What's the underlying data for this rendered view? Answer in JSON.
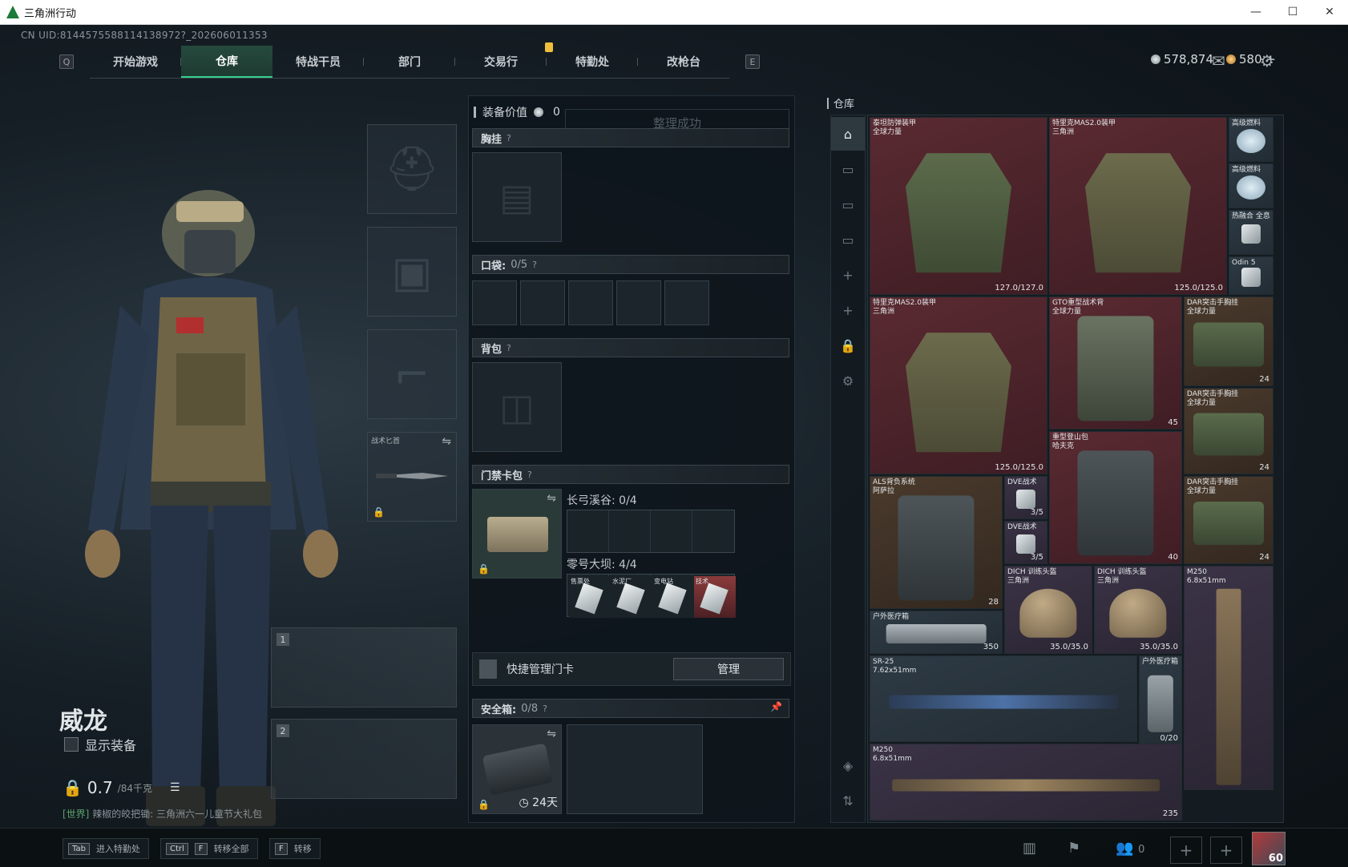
{
  "window": {
    "title": "三角洲行动",
    "minimize": "—",
    "maximize": "☐",
    "close": "✕"
  },
  "uid": "CN UID:8144575588114138972?_202606011353",
  "nav": {
    "left_key": "Q",
    "right_key": "E",
    "tabs": [
      "开始游戏",
      "仓库",
      "特战干员",
      "部门",
      "交易行",
      "特勤处",
      "改枪台"
    ],
    "active_tab": "仓库"
  },
  "currency": {
    "silver": "578,874",
    "gold": "580",
    "gold_plus": "+"
  },
  "operator": {
    "name": "威龙",
    "show_equipment": "显示装备",
    "weight": "0.7",
    "weight_max": "/84千克",
    "chat_channel": "[世界]",
    "chat_text": "辣椒的皎把锄: 三角洲六一儿童节大礼包"
  },
  "equip_slots": {
    "melee_label": "战术匕首",
    "weapon1_num": "1",
    "weapon2_num": "2"
  },
  "middle": {
    "equip_value_label": "装备价值",
    "equip_value": "0",
    "toast": "整理成功",
    "chest_rig": "胸挂",
    "pockets": "口袋:",
    "pockets_count": "0/5",
    "backpack": "背包",
    "keycard_wallet": "门禁卡包",
    "changgong_label": "长弓溪谷: 0/4",
    "linghao_label": "零号大坝: 4/4",
    "keycards": [
      {
        "name": "售票处",
        "color": "blue"
      },
      {
        "name": "水泥厂",
        "color": "blue"
      },
      {
        "name": "变电站",
        "color": "blue"
      },
      {
        "name": "技术",
        "color": "red"
      }
    ],
    "quick_manage": "快捷管理门卡",
    "manage_button": "管理",
    "safe_box": "安全箱:",
    "safe_box_count": "0/8",
    "safe_timer": "24天",
    "question": "?"
  },
  "stash": {
    "title": "仓库",
    "items": [
      {
        "name": "泰坦防弹装甲\n全球力量",
        "durability": "127.0/127.0"
      },
      {
        "name": "特里克MAS2.0装甲\n三角洲",
        "durability": "125.0/125.0"
      },
      {
        "name": "高级燃料",
        "durability": ""
      },
      {
        "name": "高级燃料",
        "durability": ""
      },
      {
        "name": "热融合 全息",
        "durability": ""
      },
      {
        "name": "Odin 5",
        "durability": ""
      },
      {
        "name": "特里克MAS2.0装甲\n三角洲",
        "durability": "125.0/125.0"
      },
      {
        "name": "GTO重型战术背\n全球力量",
        "durability": "45"
      },
      {
        "name": "DAR突击手胸挂\n全球力量",
        "durability": "24"
      },
      {
        "name": "DAR突击手胸挂\n全球力量",
        "durability": "24"
      },
      {
        "name": "重型登山包\n哈夫克",
        "durability": "40"
      },
      {
        "name": "ALS背负系统\n阿萨拉",
        "durability": "28"
      },
      {
        "name": "DVE战术",
        "durability": "3/5"
      },
      {
        "name": "DVE战术",
        "durability": "3/5"
      },
      {
        "name": "DAR突击手胸挂\n全球力量",
        "durability": "24"
      },
      {
        "name": "DICH 训练头盔\n三角洲",
        "durability": "35.0/35.0"
      },
      {
        "name": "DICH 训练头盔\n三角洲",
        "durability": "35.0/35.0"
      },
      {
        "name": "M250\n6.8x51mm",
        "durability": ""
      },
      {
        "name": "户外医疗箱",
        "durability": "350"
      },
      {
        "name": "SR-25\n7.62x51mm",
        "durability": ""
      },
      {
        "name": "户外医疗箱",
        "durability": "0/20"
      },
      {
        "name": "M250\n6.8x51mm",
        "durability": "235"
      }
    ]
  },
  "bottom": {
    "hint1_key": "Tab",
    "hint1": "进入特勤处",
    "hint2_key1": "Ctrl",
    "hint2_key2": "F",
    "hint2": "转移全部",
    "hint3_key": "F",
    "hint3": "转移",
    "friends": "0",
    "level": "60"
  }
}
